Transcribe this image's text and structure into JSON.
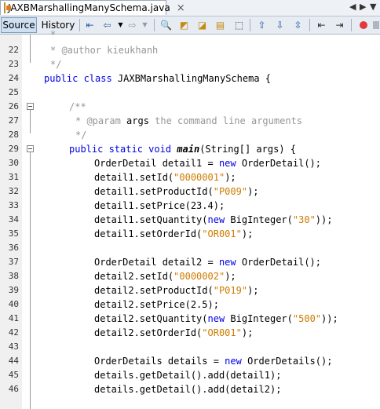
{
  "tab": {
    "title": "JAXBMarshallingManySchema.java",
    "close": "×"
  },
  "toolbar": {
    "source_label": "Source",
    "history_label": "History"
  },
  "code": {
    "l21": "*",
    "l22_prefix": "* ",
    "l22_tag": "@author",
    "l22_rest": " kieukhanh",
    "l23": "*/",
    "l24_kw": "public class",
    "l24_rest": " JAXBMarshallingManySchema {",
    "l26": "/**",
    "l27_prefix": "* ",
    "l27_tag": "@param",
    "l27_name": " args",
    "l27_rest": " the command line arguments",
    "l28": "*/",
    "l29_kw": "public static void",
    "l29_method": "main",
    "l29_rest": "(String[] args) {",
    "l30_a": "OrderDetail detail1 = ",
    "l30_kw": "new",
    "l30_b": " OrderDetail();",
    "l31_a": "detail1.setId(",
    "l31_s": "\"0000001\"",
    "l31_b": ");",
    "l32_a": "detail1.setProductId(",
    "l32_s": "\"P009\"",
    "l32_b": ");",
    "l33": "detail1.setPrice(23.4);",
    "l34_a": "detail1.setQuantity(",
    "l34_kw": "new",
    "l34_b": " BigInteger(",
    "l34_s": "\"30\"",
    "l34_c": "));",
    "l35_a": "detail1.setOrderId(",
    "l35_s": "\"OR001\"",
    "l35_b": ");",
    "l37_a": "OrderDetail detail2 = ",
    "l37_kw": "new",
    "l37_b": " OrderDetail();",
    "l38_a": "detail2.setId(",
    "l38_s": "\"0000002\"",
    "l38_b": ");",
    "l39_a": "detail2.setProductId(",
    "l39_s": "\"P019\"",
    "l39_b": ");",
    "l40": "detail2.setPrice(2.5);",
    "l41_a": "detail2.setQuantity(",
    "l41_kw": "new",
    "l41_b": " BigInteger(",
    "l41_s": "\"500\"",
    "l41_c": "));",
    "l42_a": "detail2.setOrderId(",
    "l42_s": "\"OR001\"",
    "l42_b": ");",
    "l44_a": "OrderDetails details = ",
    "l44_kw": "new",
    "l44_b": " OrderDetails();",
    "l45": "details.getDetail().add(detail1);",
    "l46": "details.getDetail().add(detail2);"
  },
  "line_numbers": [
    "22",
    "23",
    "24",
    "25",
    "26",
    "27",
    "28",
    "29",
    "30",
    "31",
    "32",
    "33",
    "34",
    "35",
    "36",
    "37",
    "38",
    "39",
    "40",
    "41",
    "42",
    "43",
    "44",
    "45",
    "46"
  ]
}
